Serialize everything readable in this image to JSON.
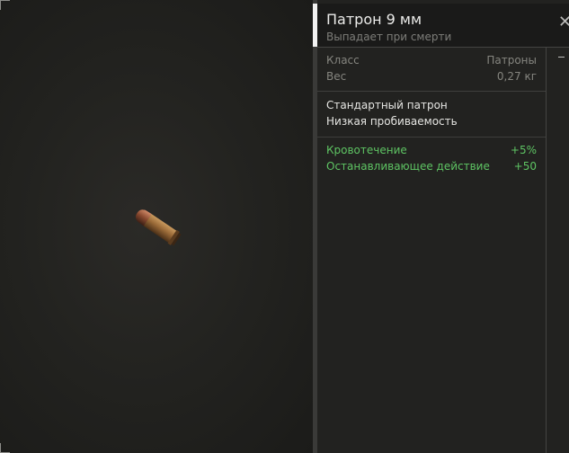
{
  "item": {
    "title": "Патрон 9 мм",
    "subtitle": "Выпадает при смерти",
    "image_icon": "bullet-9mm-icon"
  },
  "header": {
    "close_icon": "close-icon"
  },
  "stats": {
    "base": [
      {
        "label": "Класс",
        "value": "Патроны"
      },
      {
        "label": "Вес",
        "value": "0,27 кг"
      }
    ],
    "description": [
      "Стандартный патрон",
      "Низкая пробиваемость"
    ],
    "bonuses": [
      {
        "label": "Кровотечение",
        "value": "+5%"
      },
      {
        "label": "Останавливающее действие",
        "value": "+50"
      }
    ]
  },
  "colors": {
    "bonus": "#5ec463",
    "muted": "#85857f",
    "accent": "#f2f2f2"
  }
}
